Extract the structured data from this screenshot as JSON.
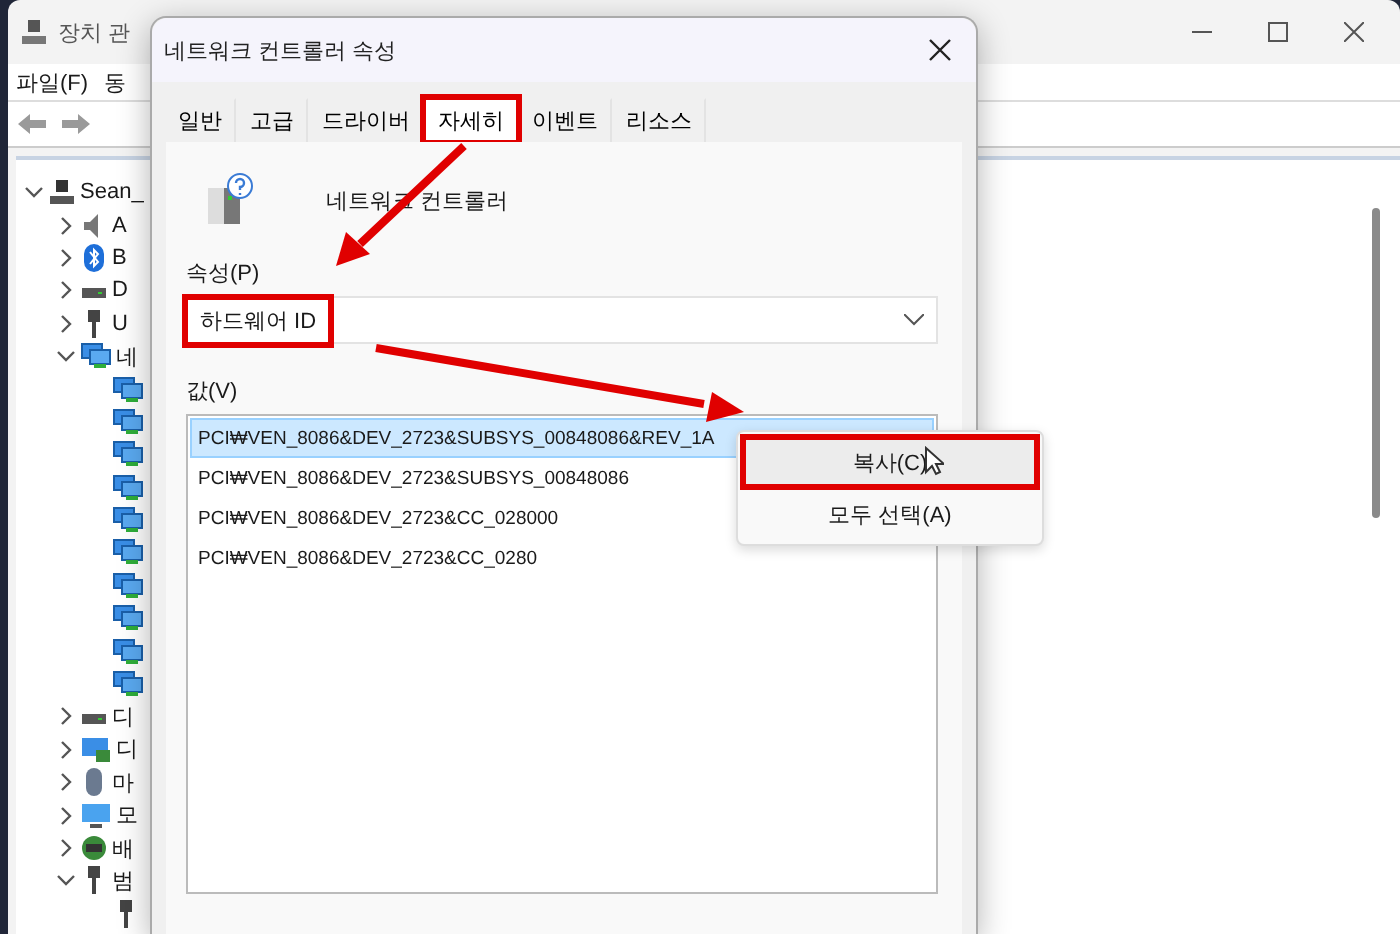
{
  "main_window": {
    "title": "장치 관",
    "menu": [
      "파일(F)",
      "동"
    ],
    "tree": [
      {
        "label": "Sean_",
        "kind": "computer",
        "expanded": true,
        "children": [
          {
            "label": "A",
            "kind": "audio",
            "expanded": false
          },
          {
            "label": "B",
            "kind": "bluetooth",
            "expanded": false
          },
          {
            "label": "D",
            "kind": "drive",
            "expanded": false
          },
          {
            "label": "U",
            "kind": "usb",
            "expanded": false
          },
          {
            "label": "네",
            "kind": "network",
            "expanded": true,
            "children": [
              {
                "kind": "adapter"
              },
              {
                "kind": "adapter"
              },
              {
                "kind": "adapter"
              },
              {
                "kind": "adapter"
              },
              {
                "kind": "adapter"
              },
              {
                "kind": "adapter"
              },
              {
                "kind": "adapter"
              },
              {
                "kind": "adapter"
              },
              {
                "kind": "adapter"
              },
              {
                "kind": "adapter"
              }
            ]
          },
          {
            "label": "디",
            "kind": "drive",
            "expanded": false
          },
          {
            "label": "디",
            "kind": "display",
            "expanded": false
          },
          {
            "label": "마",
            "kind": "mouse",
            "expanded": false
          },
          {
            "label": "모",
            "kind": "monitor",
            "expanded": false
          },
          {
            "label": "배",
            "kind": "battery",
            "expanded": false
          },
          {
            "label": "범",
            "kind": "usb",
            "expanded": true,
            "children": [
              {
                "kind": "usb"
              }
            ]
          }
        ]
      }
    ]
  },
  "dialog": {
    "title": "네트워크 컨트롤러 속성",
    "tabs": [
      {
        "label": "일반",
        "selected": false,
        "annotated": false
      },
      {
        "label": "고급",
        "selected": false,
        "annotated": false
      },
      {
        "label": "드라이버",
        "selected": false,
        "annotated": false
      },
      {
        "label": "자세히",
        "selected": true,
        "annotated": true
      },
      {
        "label": "이벤트",
        "selected": false,
        "annotated": false
      },
      {
        "label": "리소스",
        "selected": false,
        "annotated": false
      }
    ],
    "device_name": "네트워크 컨트롤러",
    "property_label": "속성(P)",
    "property": {
      "value": "하드웨어 ID",
      "annotated": true
    },
    "value_label": "값(V)",
    "values": [
      {
        "text": "PCI₩VEN_8086&DEV_2723&SUBSYS_00848086&REV_1A",
        "selected": true
      },
      {
        "text": "PCI₩VEN_8086&DEV_2723&SUBSYS_00848086",
        "selected": false
      },
      {
        "text": "PCI₩VEN_8086&DEV_2723&CC_028000",
        "selected": false
      },
      {
        "text": "PCI₩VEN_8086&DEV_2723&CC_0280",
        "selected": false
      }
    ]
  },
  "context_menu": [
    {
      "label": "복사(C)",
      "hovered": true,
      "annotated": true
    },
    {
      "label": "모두 선택(A)",
      "hovered": false,
      "annotated": false
    }
  ]
}
